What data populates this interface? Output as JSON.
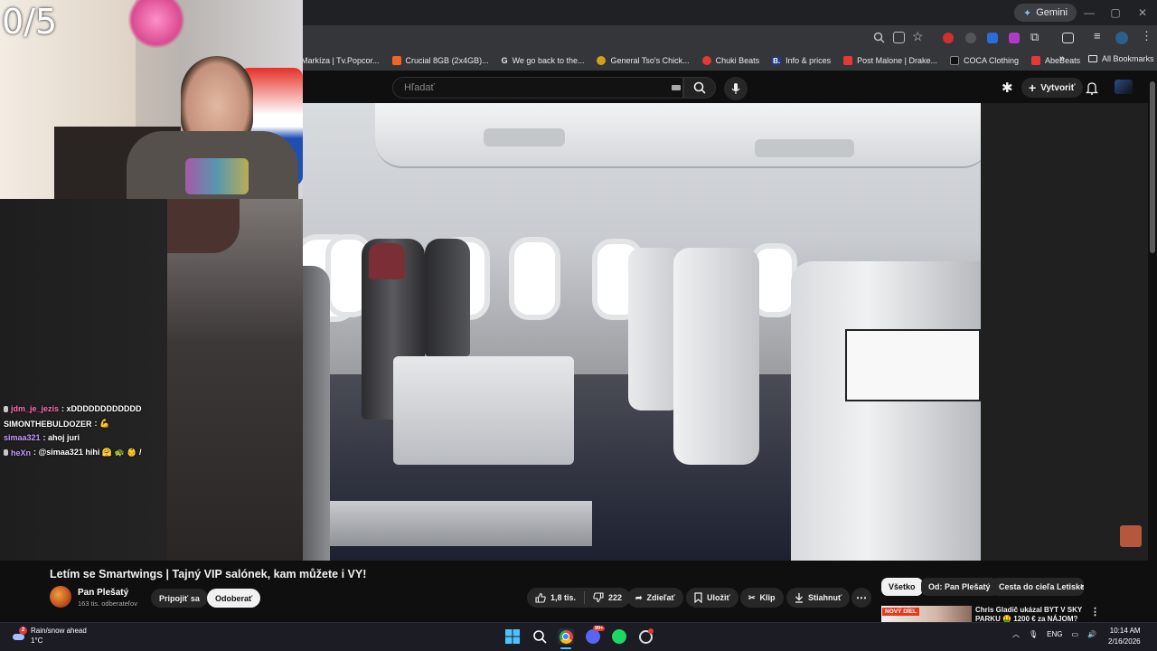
{
  "window": {
    "gemini_label": "Gemini",
    "buttons": [
      "—",
      "▢",
      "✕"
    ]
  },
  "bookmarks": {
    "items": [
      {
        "label": "Markíza | Tv.Popcor...",
        "color": "#1a73e8"
      },
      {
        "label": "Crucial 8GB (2x4GB)...",
        "color": "#f26522"
      },
      {
        "label": "We go back to the...",
        "color": "#ffffff",
        "glyph": "G"
      },
      {
        "label": "General Tso's Chick...",
        "color": "#d4a017"
      },
      {
        "label": "Chuki Beats",
        "color": "#e53935"
      },
      {
        "label": "Info & prices",
        "color": "#1e3a8a",
        "glyph": "B."
      },
      {
        "label": "Post Malone | Drake...",
        "color": "#e53935"
      },
      {
        "label": "COCA Clothing",
        "color": "#222222"
      },
      {
        "label": "AbeBeats",
        "color": "#e53935"
      }
    ],
    "overflow": "»",
    "all_bookmarks": "All Bookmarks"
  },
  "youtube": {
    "search_placeholder": "Hľadať",
    "create_label": "Vytvoriť"
  },
  "stream": {
    "cam_counter": "0/5",
    "chat": [
      {
        "user": "jdm_je_jezis",
        "user_color": "#ff6fb5",
        "message": ": xDDDDDDDDDDDD"
      },
      {
        "user": "SIMONTHEBULDOZER",
        "user_color": "#ffffff",
        "message": ": 💪"
      },
      {
        "user": "simaa321",
        "user_color": "#c39bff",
        "message": ": ahoj juri"
      },
      {
        "user": "heXn",
        "user_color": "#c39bff",
        "message": ": @simaa321 hihi 🤗 🐢 👶 /"
      }
    ]
  },
  "video": {
    "title": "Letím se Smartwings | Tajný VIP salónek, kam můžete i VY!",
    "channel_name": "Pan Plešatý",
    "channel_subs": "163 tis. odberateľov",
    "join_label": "Pripojiť sa",
    "subscribe_label": "Odoberať",
    "likes": "1,8 tis.",
    "dislikes": "222",
    "share_label": "Zdieľať",
    "save_label": "Uložiť",
    "clip_label": "Klip",
    "download_label": "Stiahnuť",
    "more": "⋯"
  },
  "recommendations": {
    "chips": [
      "Všetko",
      "Od: Pan Plešatý",
      "Cesta do cieľa Letisko"
    ],
    "first": {
      "badge": "NOVÝ DÍEL",
      "title": "Chris Gladič ukázal BYT V SKY PARKU 🤑 1200 € za NÁJOM?"
    }
  },
  "taskbar": {
    "weather_line1": "Rain/snow ahead",
    "weather_line2": "1°C",
    "weather_badge": "2",
    "discord_badge": "99+",
    "lang": "ENG",
    "time": "10:14 AM",
    "date": "2/16/2026"
  }
}
